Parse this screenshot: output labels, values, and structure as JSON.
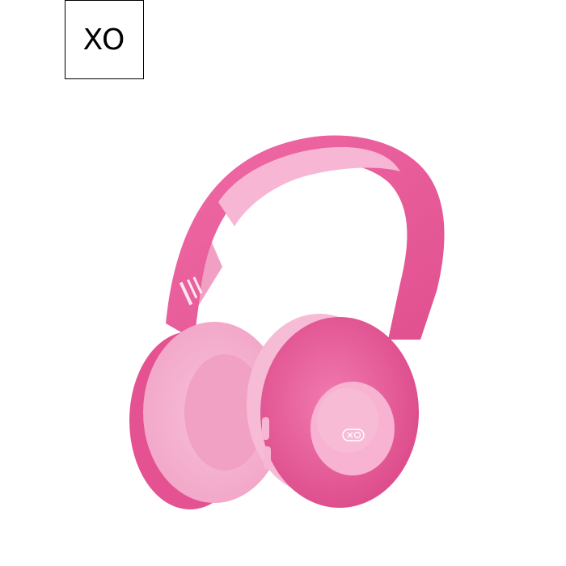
{
  "brand": {
    "logo_text": "XO"
  },
  "product_image": {
    "icon": "headphones-icon",
    "colors": {
      "main": "#ec5a9b",
      "light": "#f5b2d0",
      "dark": "#d8417f"
    }
  }
}
